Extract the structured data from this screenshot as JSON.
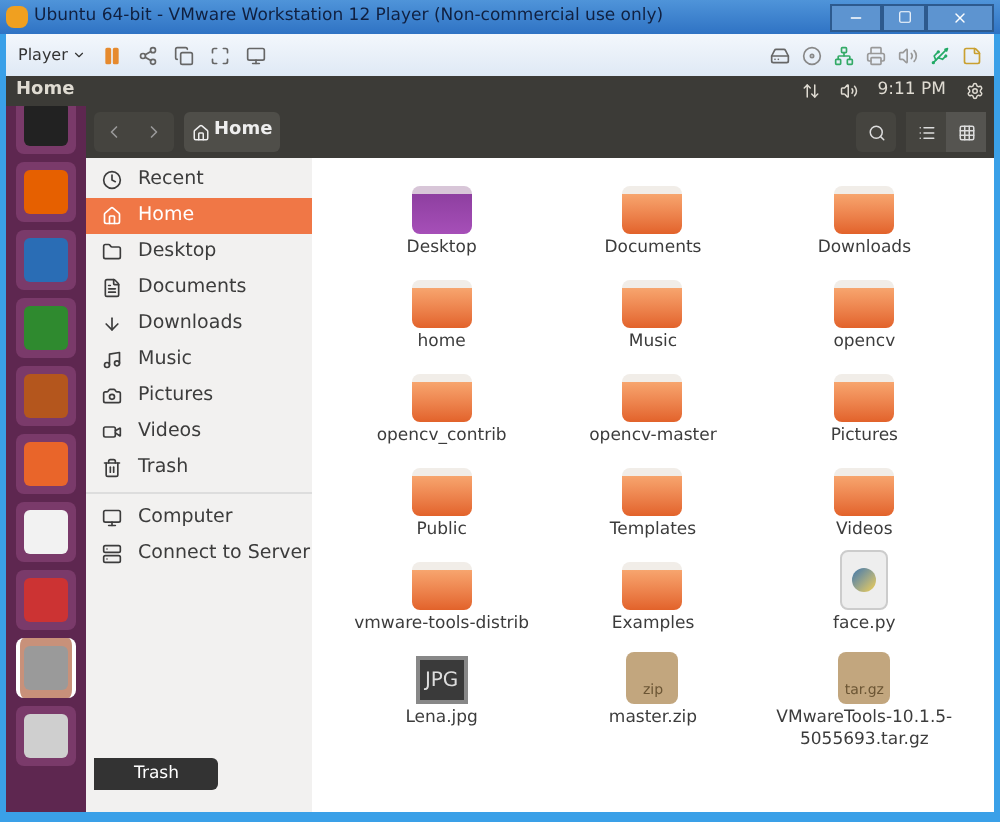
{
  "window": {
    "title": "Ubuntu 64-bit - VMware Workstation 12 Player (Non-commercial use only)"
  },
  "player_menu": {
    "label": "Player"
  },
  "top_panel": {
    "title": "Home",
    "clock": "9:11 PM"
  },
  "launcher": [
    {
      "selected": false
    },
    {
      "selected": false
    },
    {
      "selected": false
    },
    {
      "selected": false
    },
    {
      "selected": false
    },
    {
      "selected": false
    },
    {
      "selected": false
    },
    {
      "selected": false
    },
    {
      "selected": true
    },
    {
      "selected": false
    }
  ],
  "tooltip": {
    "label": "Trash"
  },
  "path_bar": {
    "label": "Home"
  },
  "view_buttons": [
    {
      "selected": false
    },
    {
      "selected": true
    }
  ],
  "sidebar": {
    "places": [
      {
        "label": "Recent",
        "selected": false
      },
      {
        "label": "Home",
        "selected": true
      },
      {
        "label": "Desktop",
        "selected": false
      },
      {
        "label": "Documents",
        "selected": false
      },
      {
        "label": "Downloads",
        "selected": false
      },
      {
        "label": "Music",
        "selected": false
      },
      {
        "label": "Pictures",
        "selected": false
      },
      {
        "label": "Videos",
        "selected": false
      },
      {
        "label": "Trash",
        "selected": false
      }
    ],
    "devices": [
      {
        "label": "Computer",
        "selected": false
      },
      {
        "label": "Connect to Server",
        "selected": false
      }
    ]
  },
  "files": [
    {
      "name": "Desktop",
      "kind": "desktop"
    },
    {
      "name": "Documents",
      "kind": "folder"
    },
    {
      "name": "Downloads",
      "kind": "folder"
    },
    {
      "name": "home",
      "kind": "folder"
    },
    {
      "name": "Music",
      "kind": "folder"
    },
    {
      "name": "opencv",
      "kind": "folder"
    },
    {
      "name": "opencv_contrib",
      "kind": "folder"
    },
    {
      "name": "opencv-master",
      "kind": "folder"
    },
    {
      "name": "Pictures",
      "kind": "folder"
    },
    {
      "name": "Public",
      "kind": "folder"
    },
    {
      "name": "Templates",
      "kind": "folder"
    },
    {
      "name": "Videos",
      "kind": "folder"
    },
    {
      "name": "vmware-tools-distrib",
      "kind": "folder"
    },
    {
      "name": "Examples",
      "kind": "folder"
    },
    {
      "name": "face.py",
      "kind": "script"
    },
    {
      "name": "Lena.jpg",
      "kind": "image",
      "badge": "JPG"
    },
    {
      "name": "master.zip",
      "kind": "archive",
      "badge": "zip"
    },
    {
      "name": "VMwareTools-10.1.5-5055693.tar.gz",
      "kind": "archive",
      "badge": "tar.gz"
    }
  ]
}
